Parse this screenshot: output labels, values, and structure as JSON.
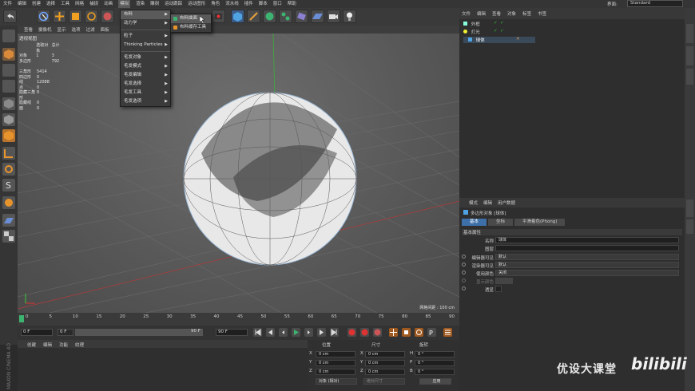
{
  "menubar": {
    "items": [
      "文件",
      "编辑",
      "创建",
      "选择",
      "工具",
      "网格",
      "捕捉",
      "动画",
      "模拟",
      "渲染",
      "雕刻",
      "运动跟踪",
      "运动图形",
      "角色",
      "流水线",
      "插件",
      "脚本",
      "窗口",
      "帮助"
    ],
    "active_index": 8,
    "layout_label": "界面:",
    "layout_value": "Standard"
  },
  "simulate_menu": {
    "items": [
      {
        "label": "布料",
        "submenu": true
      },
      {
        "label": "动力学",
        "submenu": true
      },
      {
        "label": "粒子",
        "submenu": true
      },
      {
        "label": "Thinking Particles",
        "submenu": true
      },
      {
        "label": "毛发对象",
        "submenu": true
      },
      {
        "label": "毛发模式",
        "submenu": true
      },
      {
        "label": "毛发编辑",
        "submenu": true
      },
      {
        "label": "毛发选择",
        "submenu": true
      },
      {
        "label": "毛发工具",
        "submenu": true
      },
      {
        "label": "毛发选项",
        "submenu": true
      }
    ],
    "cloth_submenu": [
      "布料曲面",
      "布料缓存工具"
    ]
  },
  "viewport": {
    "menu": [
      "查看",
      "摄像机",
      "显示",
      "选项",
      "过滤",
      "面板"
    ],
    "view_name": "透视视图",
    "stats_header": [
      "",
      "选取对象",
      "总计"
    ],
    "stats_rows": [
      {
        "k": "对象",
        "a": "1",
        "b": "3"
      },
      {
        "k": "多边形",
        "a": "",
        "b": "792"
      }
    ],
    "stats_rows2": [
      {
        "k": "三角形",
        "v": "5414"
      },
      {
        "k": "四边形",
        "v": "0"
      },
      {
        "k": "线",
        "v": "12088"
      },
      {
        "k": "点",
        "v": "0"
      },
      {
        "k": "隐藏三角形",
        "v": "0"
      },
      {
        "k": "隐藏线",
        "v": "0"
      },
      {
        "k": "面",
        "v": "0"
      }
    ],
    "grid_spacing": "网格间距 : 100 cm"
  },
  "timeline": {
    "ticks": [
      "0",
      "5",
      "10",
      "15",
      "20",
      "25",
      "30",
      "35",
      "40",
      "45",
      "50",
      "55",
      "60",
      "65",
      "70",
      "75",
      "80",
      "85",
      "90"
    ],
    "current": "0 F",
    "start": "0 F",
    "end": "90 F",
    "end2": "90 F"
  },
  "materials": {
    "menu": [
      "创建",
      "编辑",
      "功能",
      "纹理"
    ]
  },
  "coords": {
    "headers": [
      "位置",
      "尺寸",
      "旋转"
    ],
    "rows": [
      {
        "axis": "X",
        "pos": "0 cm",
        "axis2": "X",
        "size": "0 cm",
        "rot_axis": "H",
        "rot": "0 °"
      },
      {
        "axis": "Y",
        "pos": "0 cm",
        "axis2": "Y",
        "size": "0 cm",
        "rot_axis": "P",
        "rot": "0 °"
      },
      {
        "axis": "Z",
        "pos": "0 cm",
        "axis2": "Z",
        "size": "0 cm",
        "rot_axis": "B",
        "rot": "0 °"
      }
    ],
    "mode": "对象 (相对)",
    "size_mode": "绝对尺寸",
    "apply": "应用"
  },
  "objects": {
    "menu": [
      "文件",
      "编辑",
      "查看",
      "对象",
      "标签",
      "书签"
    ],
    "items": [
      {
        "name": "外框",
        "selected": false
      },
      {
        "name": "灯光",
        "selected": false
      },
      {
        "name": "球体",
        "selected": true
      }
    ]
  },
  "attributes": {
    "menu": [
      "模式",
      "编辑",
      "用户数据"
    ],
    "object_title": "多边形对象 [球体]",
    "tabs": [
      "基本",
      "坐标",
      "平滑着色(Phong)"
    ],
    "section": "基本属性",
    "rows": [
      {
        "label": "名称",
        "value": "球体"
      },
      {
        "label": "图层",
        "value": ""
      },
      {
        "label": "编辑器可见",
        "value": "默认"
      },
      {
        "label": "渲染器可见",
        "value": "默认"
      },
      {
        "label": "使用颜色",
        "value": "关闭"
      },
      {
        "label": "显示颜色",
        "value": ""
      },
      {
        "label": "透显",
        "value": ""
      }
    ]
  },
  "watermark": {
    "text": "优设大课堂",
    "brand": "bilibili"
  },
  "side_logo": "MAXON CINEMA 4D",
  "colors": {
    "accent": "#3d6fa8",
    "panel": "#2e2e2e",
    "viewport": "#5e5e5e"
  }
}
